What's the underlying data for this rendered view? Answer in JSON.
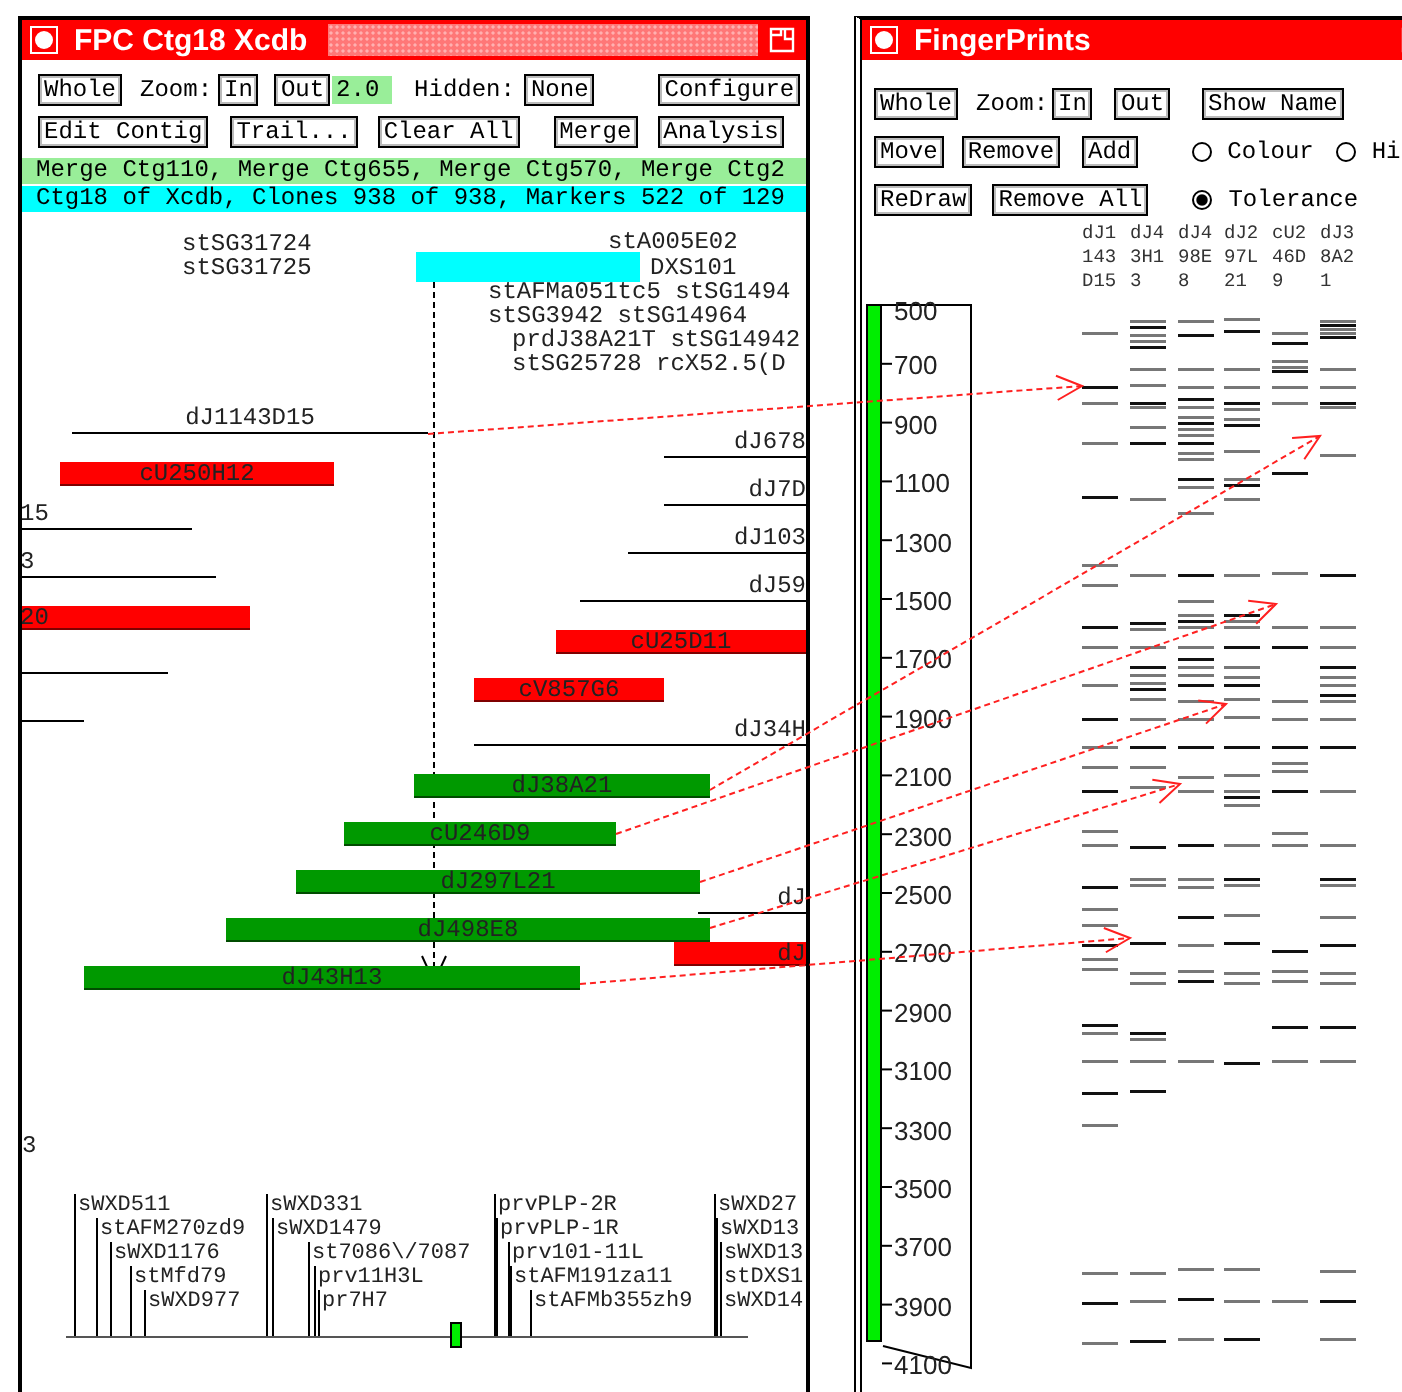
{
  "contig_window": {
    "title": "FPC Ctg18 Xcdb",
    "toolbar": [
      [
        {
          "kind": "button",
          "label": "Whole"
        },
        {
          "kind": "text",
          "label": "Zoom:"
        },
        {
          "kind": "button",
          "label": "In"
        },
        {
          "kind": "button",
          "label": "Out"
        },
        {
          "kind": "field",
          "value": "2.0"
        },
        {
          "kind": "text",
          "label": "Hidden:"
        },
        {
          "kind": "button",
          "label": "None"
        },
        {
          "kind": "button",
          "label": "Configure"
        }
      ],
      [
        {
          "kind": "button",
          "label": "Edit Contig"
        },
        {
          "kind": "button",
          "label": "Trail..."
        },
        {
          "kind": "button",
          "label": "Clear All"
        },
        {
          "kind": "button",
          "label": "Merge"
        },
        {
          "kind": "button",
          "label": "Analysis"
        }
      ]
    ],
    "merge_line": "Merge Ctg110, Merge Ctg655, Merge Ctg570, Merge Ctg2",
    "status_line": "Ctg18 of Xcdb, Clones 938 of 938, Markers 522 of 129",
    "top_markers": [
      {
        "label": "stSG31724",
        "highlighted": false
      },
      {
        "label": "stSG31725",
        "highlighted": false
      },
      {
        "label": "stA005E02",
        "highlighted": false
      },
      {
        "label": "DXS101",
        "highlighted": true
      },
      {
        "label": "stAFMa051tc5 stSG1494",
        "highlighted": false
      },
      {
        "label": "stSG3942 stSG14964",
        "highlighted": false
      },
      {
        "label": "prdJ38A21T stSG14942",
        "highlighted": false
      },
      {
        "label": "stSG25728 rcX52.5(D",
        "highlighted": false
      }
    ],
    "clones": [
      {
        "kind": "line",
        "label": "dJ1143D15"
      },
      {
        "kind": "line",
        "label": "dJ678"
      },
      {
        "kind": "bar",
        "label": "cU250H12",
        "color": "#ff0000"
      },
      {
        "kind": "line",
        "label": "dJ7D"
      },
      {
        "kind": "line",
        "label": "15"
      },
      {
        "kind": "line",
        "label": "dJ103"
      },
      {
        "kind": "line",
        "label": "3"
      },
      {
        "kind": "line",
        "label": "dJ59"
      },
      {
        "kind": "bar",
        "label": "20",
        "color": "#ff0000"
      },
      {
        "kind": "bar",
        "label": "cU25D11",
        "color": "#ff0000"
      },
      {
        "kind": "line"
      },
      {
        "kind": "bar",
        "label": "cV857G6",
        "color": "#ff0000"
      },
      {
        "kind": "line"
      },
      {
        "kind": "line",
        "label": "dJ34H"
      },
      {
        "kind": "bar",
        "label": "dJ38A21",
        "color": "#009900"
      },
      {
        "kind": "bar",
        "label": "cU246D9",
        "color": "#009900"
      },
      {
        "kind": "bar",
        "label": "dJ297L21",
        "color": "#009900"
      },
      {
        "kind": "line",
        "label": "dJ"
      },
      {
        "kind": "bar",
        "label": "dJ498E8",
        "color": "#009900"
      },
      {
        "kind": "bar",
        "label": "dJ",
        "color": "#ff0000"
      },
      {
        "kind": "bar",
        "label": "dJ43H13",
        "color": "#009900"
      }
    ],
    "edge_label": "3",
    "markers": [
      {
        "label": "sWXD511"
      },
      {
        "label": "stAFM270zd9"
      },
      {
        "label": "sWXD1176"
      },
      {
        "label": "stMfd79"
      },
      {
        "label": "sWXD977"
      },
      {
        "label": "sWXD331"
      },
      {
        "label": "sWXD1479"
      },
      {
        "label": "st7086\\/7087"
      },
      {
        "label": "prv11H3L"
      },
      {
        "label": "pr7H7"
      },
      {
        "label": "prvPLP-2R"
      },
      {
        "label": "prvPLP-1R"
      },
      {
        "label": "prv101-11L"
      },
      {
        "label": "stAFM191za11"
      },
      {
        "label": "stAFMb355zh9"
      },
      {
        "label": "sWXD27"
      },
      {
        "label": "sWXD13"
      },
      {
        "label": "sWXD13"
      },
      {
        "label": "stDXS1"
      },
      {
        "label": "sWXD14"
      }
    ]
  },
  "fingerprint_window": {
    "title": "FingerPrints",
    "toolbar": [
      [
        {
          "kind": "button",
          "label": "Whole"
        },
        {
          "kind": "text",
          "label": "Zoom:"
        },
        {
          "kind": "button",
          "label": "In"
        },
        {
          "kind": "button",
          "label": "Out"
        },
        {
          "kind": "button",
          "label": "Show Name"
        }
      ],
      [
        {
          "kind": "button",
          "label": "Move"
        },
        {
          "kind": "button",
          "label": "Remove"
        },
        {
          "kind": "button",
          "label": "Add"
        },
        {
          "kind": "radio",
          "label": "Colour",
          "selected": false
        },
        {
          "kind": "radio",
          "label": "Hi",
          "selected": false
        }
      ],
      [
        {
          "kind": "button",
          "label": "ReDraw"
        },
        {
          "kind": "button",
          "label": "Remove All"
        },
        {
          "kind": "radio",
          "label": "Tolerance",
          "selected": true
        }
      ]
    ],
    "lanes": [
      {
        "lines": [
          "dJ1",
          "143",
          "D15"
        ]
      },
      {
        "lines": [
          "dJ4",
          "3H1",
          "3"
        ]
      },
      {
        "lines": [
          "dJ4",
          "98E",
          "8"
        ]
      },
      {
        "lines": [
          "dJ2",
          "97L",
          "21"
        ]
      },
      {
        "lines": [
          "cU2",
          "46D",
          "9"
        ]
      },
      {
        "lines": [
          "dJ3",
          "8A2",
          "1"
        ]
      }
    ],
    "scale": [
      "500",
      "700",
      "900",
      "1100",
      "1300",
      "1500",
      "1700",
      "1900",
      "2100",
      "2300",
      "2500",
      "2700",
      "2900",
      "3100",
      "3300",
      "3500",
      "3700",
      "3900",
      "4100"
    ]
  }
}
